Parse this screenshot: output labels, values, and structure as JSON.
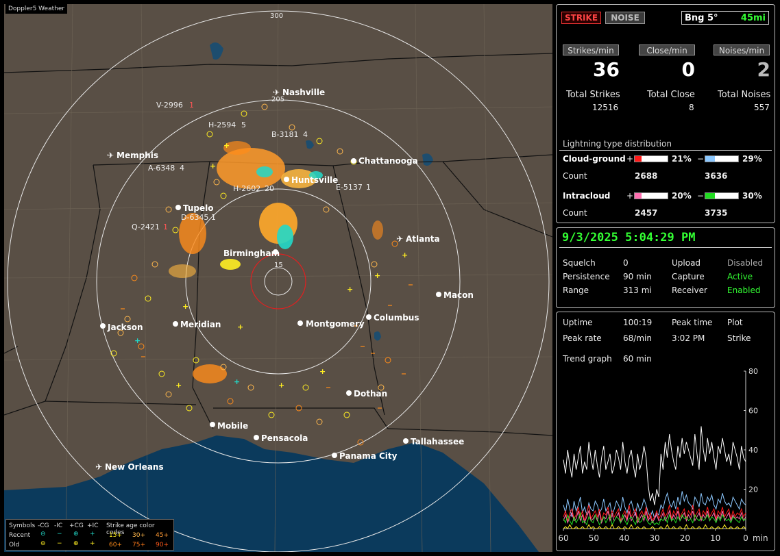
{
  "app": {
    "title": "Doppler5 Weather",
    "credit": ""
  },
  "header": {
    "strike_tab": "STRIKE",
    "noise_tab": "NOISE",
    "bearing": "Bng 5°",
    "distance": "45mi"
  },
  "rates": {
    "strikes_label": "Strikes/min",
    "close_label": "Close/min",
    "noises_label": "Noises/min",
    "strikes": "36",
    "close": "0",
    "noises": "2",
    "total_strikes_label": "Total Strikes",
    "total_close_label": "Total Close",
    "total_noises_label": "Total Noises",
    "total_strikes": "12516",
    "total_close": "8",
    "total_noises": "557"
  },
  "distribution": {
    "title": "Lightning type distribution",
    "cg_label": "Cloud-ground",
    "ic_label": "Intracloud",
    "count_label": "Count",
    "plus_sign": "+",
    "minus_sign": "−",
    "cg_plus_pct": "21%",
    "cg_minus_pct": "29%",
    "cg_plus_count": "2688",
    "cg_minus_count": "3636",
    "ic_plus_pct": "20%",
    "ic_minus_pct": "30%",
    "ic_plus_count": "2457",
    "ic_minus_count": "3735",
    "cg_plus_fill": 0.21,
    "cg_minus_fill": 0.29,
    "ic_plus_fill": 0.2,
    "ic_minus_fill": 0.3,
    "colors": {
      "cg_plus": "#ff1a1a",
      "cg_minus": "#8cc8ff",
      "ic_plus": "#ff6fb0",
      "ic_minus": "#22dd22"
    }
  },
  "status": {
    "datetime": "9/3/2025 5:04:29 PM",
    "squelch_label": "Squelch",
    "squelch": "0",
    "persistence_label": "Persistence",
    "persistence": "90 min",
    "range_label": "Range",
    "range": "313 mi",
    "upload_label": "Upload",
    "upload": "Disabled",
    "capture_label": "Capture",
    "capture": "Active",
    "receiver_label": "Receiver",
    "receiver": "Enabled"
  },
  "trend": {
    "uptime_label": "Uptime",
    "uptime": "100:19",
    "peak_time_label": "Peak time",
    "peak_time": "3:02 PM",
    "plot_label": "Plot",
    "plot": "Strike",
    "peak_rate_label": "Peak rate",
    "peak_rate": "68/min",
    "trend_label": "Trend graph",
    "trend_value": "60 min"
  },
  "chart_data": {
    "type": "line",
    "xlabel": "min",
    "x_ticks": [
      "60",
      "50",
      "40",
      "30",
      "20",
      "10",
      "0"
    ],
    "y_ticks": [
      "80",
      "60",
      "40",
      "20"
    ],
    "xlim": [
      60,
      0
    ],
    "ylim": [
      0,
      80
    ],
    "series": [
      {
        "color": "#ffffff",
        "values": [
          35,
          28,
          40,
          32,
          26,
          38,
          30,
          36,
          42,
          28,
          34,
          30,
          44,
          36,
          30,
          40,
          32,
          26,
          36,
          42,
          30,
          34,
          38,
          28,
          32,
          40,
          36,
          30,
          44,
          34,
          28,
          36,
          40,
          32,
          26,
          38,
          30,
          34,
          42,
          36,
          22,
          14,
          18,
          12,
          20,
          16,
          38,
          30,
          44,
          36,
          48,
          40,
          34,
          30,
          42,
          36,
          46,
          38,
          44,
          40,
          36,
          32,
          48,
          38,
          30,
          52,
          40,
          34,
          46,
          38,
          44,
          36,
          30,
          42,
          38,
          46,
          40,
          34,
          38,
          32,
          44,
          40,
          36,
          30,
          42,
          36,
          34
        ]
      },
      {
        "color": "#8cc8ff",
        "values": [
          12,
          8,
          15,
          10,
          6,
          14,
          9,
          12,
          16,
          8,
          11,
          7,
          13,
          10,
          9,
          14,
          12,
          8,
          10,
          15,
          9,
          11,
          13,
          7,
          10,
          14,
          12,
          9,
          16,
          11,
          8,
          12,
          14,
          10,
          7,
          13,
          9,
          11,
          15,
          12,
          8,
          6,
          9,
          5,
          8,
          7,
          12,
          10,
          15,
          18,
          13,
          11,
          14,
          10,
          16,
          12,
          19,
          14,
          17,
          13,
          12,
          10,
          16,
          14,
          11,
          18,
          13,
          12,
          16,
          14,
          17,
          12,
          10,
          15,
          13,
          18,
          14,
          12,
          13,
          11,
          16,
          14,
          12,
          10,
          15,
          13,
          12
        ]
      },
      {
        "color": "#ff1a1a",
        "values": [
          6,
          9,
          4,
          8,
          10,
          5,
          7,
          11,
          6,
          9,
          4,
          8,
          12,
          5,
          7,
          9,
          6,
          10,
          4,
          8,
          7,
          11,
          5,
          9,
          6,
          8,
          10,
          4,
          7,
          9,
          5,
          12,
          6,
          8,
          10,
          4,
          7,
          9,
          6,
          11,
          5,
          8,
          4,
          6,
          9,
          5,
          7,
          10,
          6,
          8,
          12,
          5,
          9,
          7,
          11,
          6,
          8,
          10,
          5,
          9,
          7,
          12,
          6,
          8,
          10,
          5,
          9,
          7,
          11,
          6,
          8,
          10,
          5,
          9,
          7,
          11,
          6,
          8,
          10,
          5,
          9,
          6,
          8,
          7,
          10,
          6,
          8
        ]
      },
      {
        "color": "#ff6fb0",
        "values": [
          4,
          7,
          3,
          6,
          8,
          4,
          5,
          9,
          4,
          7,
          3,
          6,
          9,
          4,
          5,
          7,
          4,
          8,
          3,
          6,
          5,
          9,
          4,
          7,
          4,
          6,
          8,
          3,
          5,
          7,
          4,
          9,
          4,
          6,
          8,
          3,
          5,
          7,
          4,
          9,
          4,
          6,
          3,
          5,
          7,
          4,
          5,
          8,
          4,
          6,
          9,
          4,
          7,
          5,
          9,
          4,
          6,
          8,
          4,
          7,
          5,
          9,
          4,
          6,
          8,
          4,
          7,
          5,
          9,
          4,
          6,
          8,
          4,
          7,
          5,
          9,
          4,
          6,
          8,
          4,
          7,
          5,
          6,
          5,
          8,
          4,
          6
        ]
      },
      {
        "color": "#22dd22",
        "values": [
          5,
          3,
          7,
          4,
          2,
          6,
          3,
          5,
          8,
          3,
          4,
          2,
          6,
          4,
          3,
          7,
          5,
          2,
          4,
          6,
          3,
          5,
          7,
          2,
          4,
          6,
          5,
          3,
          7,
          4,
          2,
          5,
          6,
          4,
          2,
          6,
          3,
          4,
          7,
          5,
          3,
          2,
          4,
          2,
          3,
          2,
          5,
          4,
          6,
          3,
          7,
          4,
          5,
          3,
          6,
          4,
          7,
          5,
          6,
          4,
          5,
          3,
          7,
          5,
          4,
          6,
          4,
          5,
          7,
          4,
          6,
          5,
          3,
          6,
          4,
          7,
          5,
          4,
          5,
          3,
          6,
          5,
          4,
          3,
          6,
          4,
          5
        ]
      },
      {
        "color": "#ffee22",
        "values": [
          0,
          1,
          0,
          2,
          0,
          0,
          1,
          0,
          0,
          1,
          0,
          0,
          2,
          0,
          1,
          0,
          0,
          1,
          0,
          0,
          1,
          0,
          0,
          2,
          0,
          0,
          1,
          0,
          0,
          1,
          0,
          0,
          2,
          0,
          0,
          1,
          0,
          0,
          1,
          0,
          0,
          0,
          1,
          0,
          0,
          0,
          1,
          0,
          0,
          2,
          0,
          0,
          1,
          0,
          0,
          1,
          0,
          0,
          2,
          0,
          0,
          1,
          0,
          0,
          1,
          0,
          0,
          2,
          0,
          0,
          1,
          0,
          0,
          1,
          0,
          0,
          2,
          0,
          0,
          1,
          0,
          0,
          1,
          0,
          0,
          1,
          0
        ]
      }
    ]
  },
  "map": {
    "range_labels": [
      "300",
      "205",
      "15"
    ],
    "cities": [
      {
        "name": "Nashville",
        "kind": "airport"
      },
      {
        "name": "Memphis",
        "kind": "airport"
      },
      {
        "name": "Chattanooga",
        "kind": "city"
      },
      {
        "name": "Huntsville",
        "kind": "city"
      },
      {
        "name": "Tupelo",
        "kind": "city"
      },
      {
        "name": "Atlanta",
        "kind": "airport"
      },
      {
        "name": "Birmingham",
        "kind": "city"
      },
      {
        "name": "Macon",
        "kind": "city"
      },
      {
        "name": "Jackson",
        "kind": "city"
      },
      {
        "name": "Meridian",
        "kind": "city"
      },
      {
        "name": "Montgomery",
        "kind": "city"
      },
      {
        "name": "Columbus",
        "kind": "city"
      },
      {
        "name": "Dothan",
        "kind": "city"
      },
      {
        "name": "Mobile",
        "kind": "city"
      },
      {
        "name": "Pensacola",
        "kind": "city"
      },
      {
        "name": "Tallahassee",
        "kind": "city"
      },
      {
        "name": "Panama City",
        "kind": "city"
      },
      {
        "name": "New Orleans",
        "kind": "airport"
      }
    ],
    "cells": [
      "V-2996",
      "H-2594",
      "B-3181",
      "A-6348",
      "H-2602",
      "E-5137",
      "D-6345",
      "Q-2421"
    ],
    "cell_counts": [
      "1",
      "5",
      "4",
      "4",
      "20",
      "1",
      "1",
      "1"
    ]
  },
  "legend": {
    "symbols_label": "Symbols",
    "headers": [
      "-CG",
      "-IC",
      "+CG",
      "+IC"
    ],
    "recent_label": "Recent",
    "old_label": "Old",
    "age_label": "Strike age color codes",
    "recent_ages": [
      "15+",
      "30+",
      "45+"
    ],
    "old_ages": [
      "60+",
      "75+",
      "90+"
    ],
    "age_colors": [
      "#ffee22",
      "#ffb84d",
      "#ff9933",
      "#ff8c1a",
      "#ff7a1a",
      "#ff5a1a"
    ]
  }
}
